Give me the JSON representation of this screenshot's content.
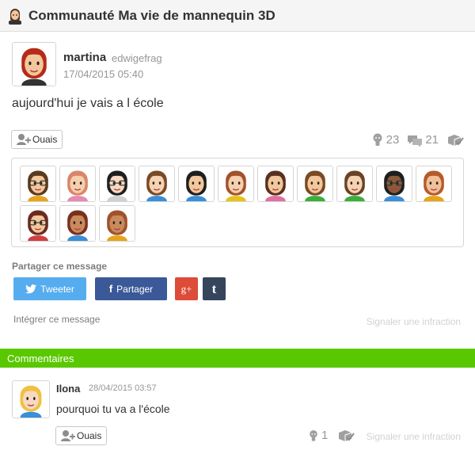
{
  "header": {
    "icon": "mii-avatar-icon",
    "title": "Communauté Ma vie de mannequin 3D"
  },
  "post": {
    "username": "martina",
    "handle": "edwigefrag",
    "date": "17/04/2015 05:40",
    "body": "aujourd'hui je vais a l école",
    "yeah_label": "Ouais",
    "yeah_count": "23",
    "comment_count": "21",
    "empathy_avatars": [
      {
        "hair": "#5a3a1e",
        "skin": "#f2c79b",
        "shirt": "#e8a31a",
        "glasses": true
      },
      {
        "hair": "#d9866a",
        "skin": "#f5cfae",
        "shirt": "#e58ab0",
        "glasses": false
      },
      {
        "hair": "#1e1e1e",
        "skin": "#f7d8c0",
        "shirt": "#d0d0d0",
        "glasses": true
      },
      {
        "hair": "#7a4a25",
        "skin": "#f6d2b2",
        "shirt": "#3a8fd8",
        "glasses": false
      },
      {
        "hair": "#1e1e1e",
        "skin": "#f2c79b",
        "shirt": "#3a8fd8",
        "glasses": false
      },
      {
        "hair": "#a0522d",
        "skin": "#f5cfae",
        "shirt": "#e8c21a",
        "glasses": false
      },
      {
        "hair": "#5a3020",
        "skin": "#f2c79b",
        "shirt": "#e070a0",
        "glasses": false
      },
      {
        "hair": "#7a4a25",
        "skin": "#f2c79b",
        "shirt": "#3cae3c",
        "glasses": false
      },
      {
        "hair": "#6b4226",
        "skin": "#f6d2b2",
        "shirt": "#3cae3c",
        "glasses": false
      },
      {
        "hair": "#1e1e1e",
        "skin": "#8a5a3a",
        "shirt": "#3a8fd8",
        "glasses": true
      },
      {
        "hair": "#b55a2a",
        "skin": "#f0c09a",
        "shirt": "#e8a31a",
        "glasses": false
      },
      {
        "hair": "#6b2a20",
        "skin": "#f2c79b",
        "shirt": "#d04040",
        "glasses": true
      },
      {
        "hair": "#7a3020",
        "skin": "#c98a5c",
        "shirt": "#3a8fd8",
        "glasses": false
      },
      {
        "hair": "#a0522d",
        "skin": "#c98a5c",
        "shirt": "#e8a31a",
        "glasses": false
      }
    ]
  },
  "share": {
    "label": "Partager ce message",
    "twitter_label": "Tweeter",
    "facebook_label": "Partager",
    "googleplus_label": "g+",
    "tumblr_label": "t",
    "embed_label": "Intégrer ce message",
    "report_label": "Signaler une infraction"
  },
  "comments": {
    "section_title": "Commentaires",
    "items": [
      {
        "username": "Ilona",
        "date": "28/04/2015 03:57",
        "body": "pourquoi tu va a l'école",
        "yeah_label": "Ouais",
        "yeah_count": "1",
        "report_label": "Signaler une infraction",
        "avatar": {
          "hair": "#f0c040",
          "skin": "#f7d8c0",
          "shirt": "#3a8fd8",
          "glasses": false
        }
      }
    ]
  },
  "colors": {
    "accent_green": "#5ac800",
    "twitter": "#55acee",
    "facebook": "#3b5998",
    "googleplus": "#dd4b39",
    "tumblr": "#35465c"
  },
  "post_avatar": {
    "hair": "#b52a18",
    "skin": "#f2c79b",
    "shirt": "#333333",
    "glasses": false
  }
}
